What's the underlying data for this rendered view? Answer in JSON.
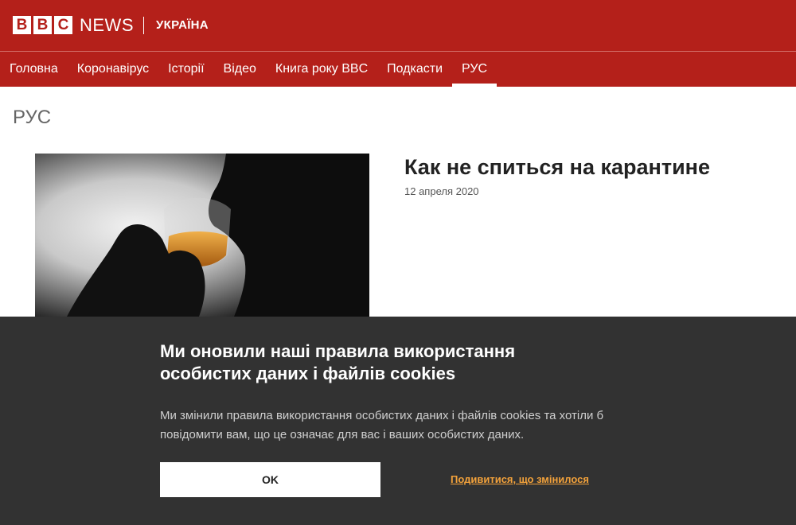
{
  "masthead": {
    "logo_letters": [
      "B",
      "B",
      "C"
    ],
    "brand": "NEWS",
    "region": "УКРАЇНА",
    "background_color": "#b4201a"
  },
  "nav": {
    "items": [
      {
        "label": "Головна",
        "active": false
      },
      {
        "label": "Коронавірус",
        "active": false
      },
      {
        "label": "Історії",
        "active": false
      },
      {
        "label": "Відео",
        "active": false
      },
      {
        "label": "Книга року BBC",
        "active": false
      },
      {
        "label": "Подкасти",
        "active": false
      },
      {
        "label": "РУС",
        "active": true
      }
    ]
  },
  "section": {
    "title": "РУС"
  },
  "story": {
    "headline": "Как не спиться на карантине",
    "date": "12 апреля 2020",
    "image_subject": "person-drinking-silhouette"
  },
  "cookie_banner": {
    "title": "Ми оновили наші правила використання особистих даних і файлів cookies",
    "body": "Ми змінили правила використання особистих даних і файлів cookies та хотіли б повідомити вам, що це означає для вас і ваших особистих даних.",
    "ok_label": "OK",
    "changes_link": "Подивитися, що змінилося",
    "background_color": "#323232",
    "link_color": "#f3a23b"
  }
}
